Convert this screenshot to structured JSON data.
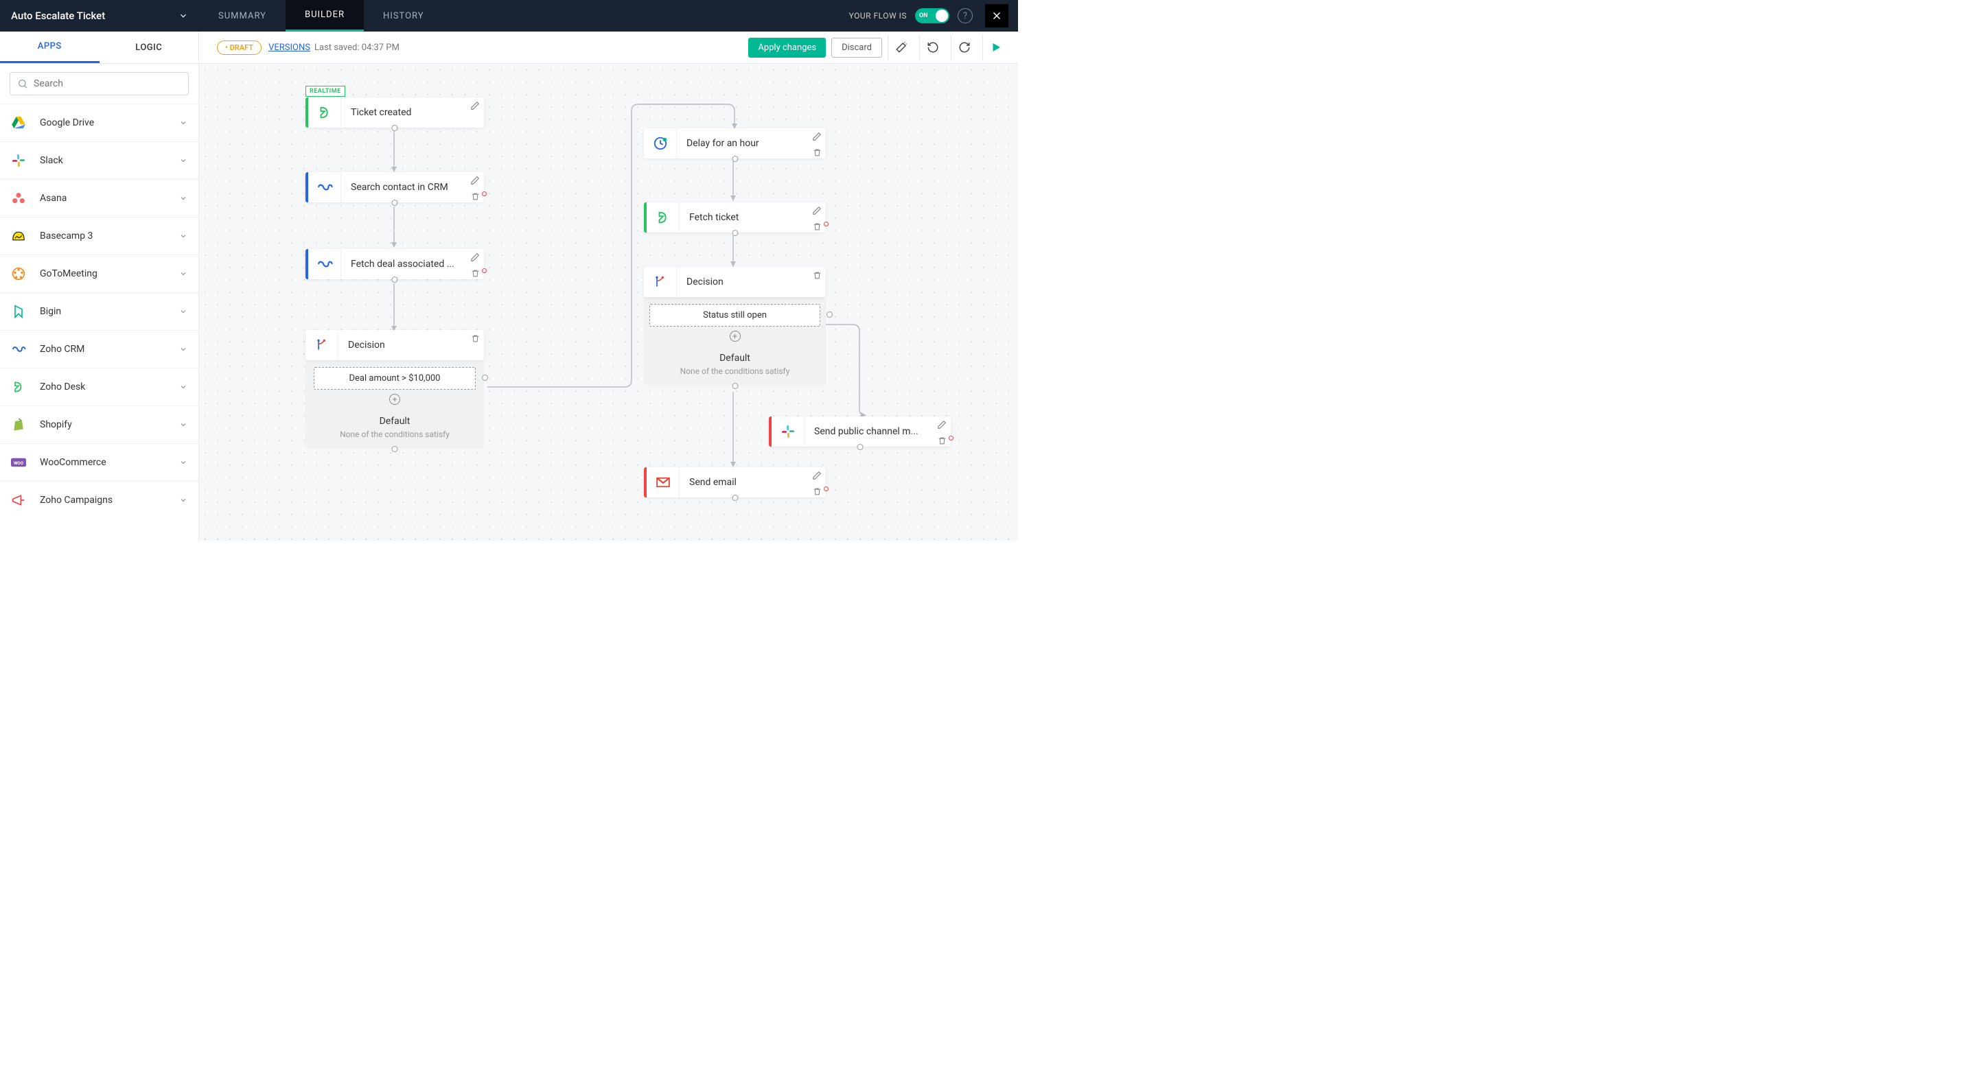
{
  "header": {
    "flow_title": "Auto Escalate Ticket",
    "tabs": {
      "summary": "SUMMARY",
      "builder": "BUILDER",
      "history": "HISTORY"
    },
    "status_label": "YOUR FLOW IS",
    "toggle_text": "ON"
  },
  "toolbar": {
    "sidebar_tabs": {
      "apps": "APPS",
      "logic": "LOGIC"
    },
    "draft": "DRAFT",
    "versions": "VERSIONS",
    "last_saved": "Last saved: 04:37 PM",
    "apply": "Apply changes",
    "discard": "Discard"
  },
  "sidebar": {
    "search_placeholder": "Search",
    "apps": [
      {
        "name": "Google Drive"
      },
      {
        "name": "Slack"
      },
      {
        "name": "Asana"
      },
      {
        "name": "Basecamp 3"
      },
      {
        "name": "GoToMeeting"
      },
      {
        "name": "Bigin"
      },
      {
        "name": "Zoho CRM"
      },
      {
        "name": "Zoho Desk"
      },
      {
        "name": "Shopify"
      },
      {
        "name": "WooCommerce"
      },
      {
        "name": "Zoho Campaigns"
      }
    ]
  },
  "canvas": {
    "realtime_tag": "REALTIME",
    "nodes": {
      "ticket_created": "Ticket created",
      "search_contact": "Search contact in CRM",
      "fetch_deal": "Fetch deal associated ...",
      "decision1": "Decision",
      "cond1": "Deal amount > $10,000",
      "default_label": "Default",
      "default_sub": "None of the conditions satisfy",
      "delay": "Delay for an hour",
      "fetch_ticket": "Fetch ticket",
      "decision2": "Decision",
      "cond2": "Status still open",
      "send_slack": "Send public channel m...",
      "send_email": "Send email"
    }
  }
}
